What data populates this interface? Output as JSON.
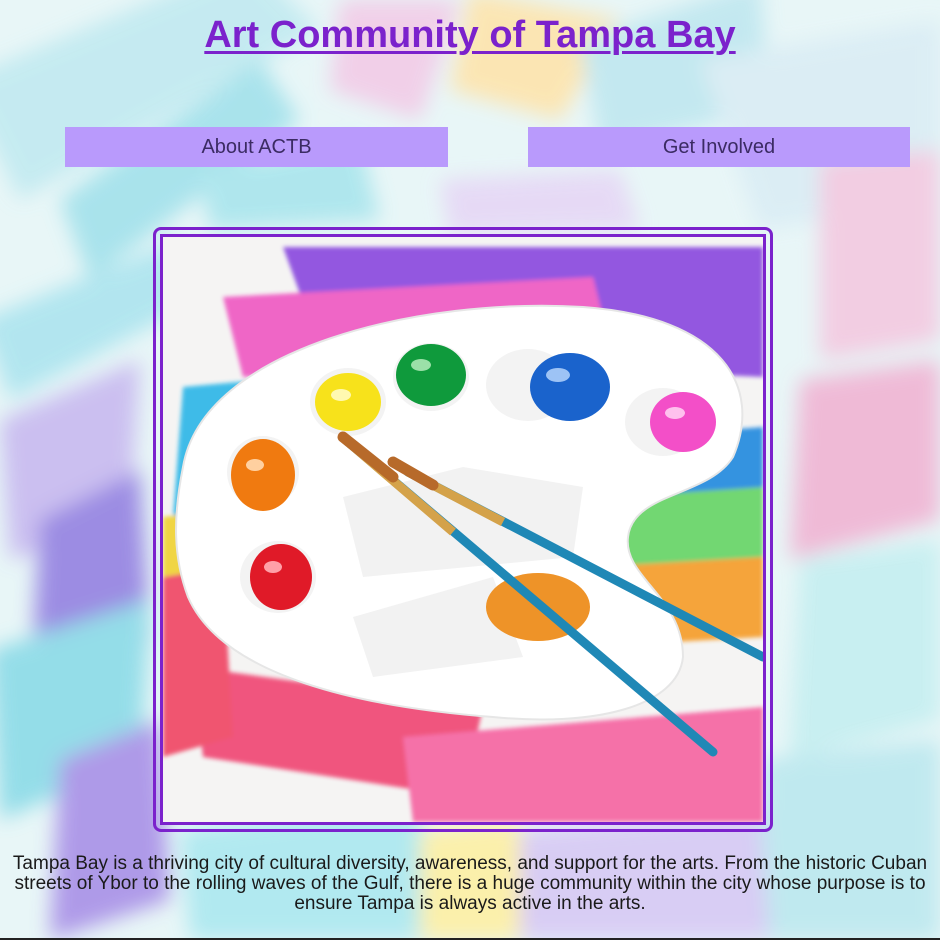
{
  "header": {
    "title": "Art Community of Tampa Bay"
  },
  "nav": {
    "about_label": "About ACTB",
    "involved_label": "Get Involved"
  },
  "hero": {
    "image_name": "paint-palette-image"
  },
  "main": {
    "description": "Tampa Bay is a thriving city of cultural diversity, awareness, and support for the arts. From the historic Cuban streets of Ybor to the rolling waves of the Gulf, there is a huge community within the city whose purpose is to ensure Tampa is always active in the arts."
  },
  "colors": {
    "accent": "#7b22cc",
    "button_bg": "#b99afc",
    "button_text": "#3b2b63"
  }
}
